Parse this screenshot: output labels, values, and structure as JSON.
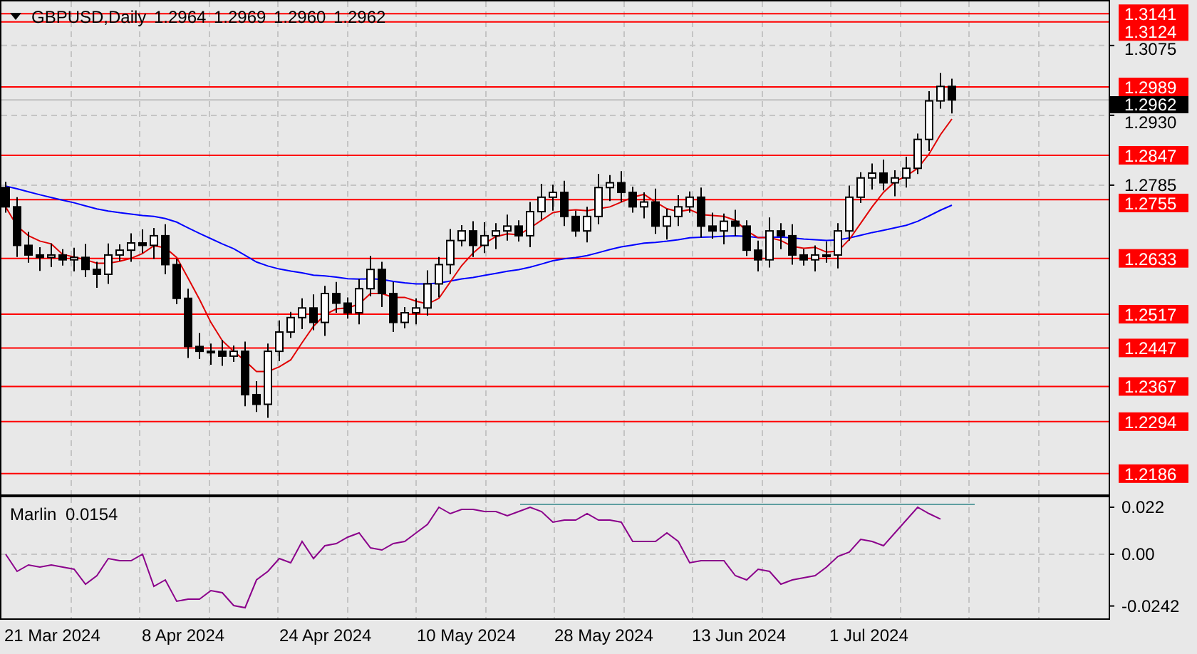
{
  "header": {
    "symbol": "GBPUSD,Daily",
    "ohlc": [
      "1.2964",
      "1.2969",
      "1.2960",
      "1.2962"
    ]
  },
  "price_axis": {
    "ticks": [
      "1.3075",
      "1.2930",
      "1.2785"
    ]
  },
  "price_levels": [
    {
      "label": "1.3141"
    },
    {
      "label": "1.3124"
    },
    {
      "label": "1.2989"
    },
    {
      "label": "1.2847"
    },
    {
      "label": "1.2755"
    },
    {
      "label": "1.2633"
    },
    {
      "label": "1.2517"
    },
    {
      "label": "1.2447"
    },
    {
      "label": "1.2367"
    },
    {
      "label": "1.2294"
    },
    {
      "label": "1.2186"
    }
  ],
  "current_price": "1.2962",
  "indicator": {
    "name": "Marlin",
    "value": "0.0154",
    "ticks": [
      "0.022",
      "0.00",
      "-0.0242"
    ]
  },
  "date_axis": [
    "21 Mar 2024",
    "8 Apr 2024",
    "24 Apr 2024",
    "10 May 2024",
    "28 May 2024",
    "13 Jun 2024",
    "1 Jul 2024"
  ]
}
